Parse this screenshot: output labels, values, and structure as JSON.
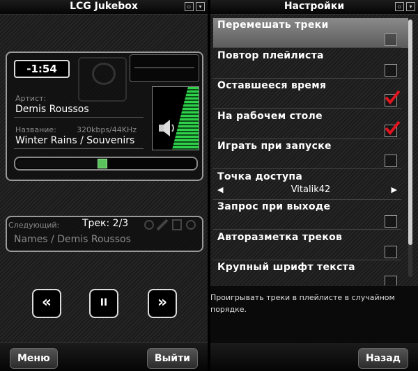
{
  "left": {
    "title": "LCG Jukebox",
    "time": "-1:54",
    "artist_label": "Артист:",
    "artist": "Demis Roussos",
    "track_label": "Название:",
    "bitrate": "320kbps/44KHz",
    "track_name": "Winter Rains / Souvenirs",
    "progress_fraction": 0.48,
    "next_label": "Следующий:",
    "track_counter": "Трек: 2/3",
    "next_track": "Names / Demis Roussos",
    "controls": {
      "prev": "«",
      "pause": "II",
      "next": "»"
    },
    "menu_label": "Меню",
    "exit_label": "Выйти"
  },
  "right": {
    "title": "Настройки",
    "items": [
      {
        "label": "Перемешать треки",
        "checked": false,
        "selected": true
      },
      {
        "label": "Повтор плейлиста",
        "checked": false
      },
      {
        "label": "Оставшееся время",
        "checked": true
      },
      {
        "label": "На рабочем столе",
        "checked": true
      },
      {
        "label": "Играть при запуске",
        "checked": false
      },
      {
        "label": "Точка доступа",
        "value": "Vitalik42"
      },
      {
        "label": "Запрос при выходе",
        "checked": false
      },
      {
        "label": "Авторазметка треков",
        "checked": false
      },
      {
        "label": "Крупный шрифт текста",
        "checked": false
      }
    ],
    "hint": "Проигрывать треки в плейлисте в случайном порядке.",
    "back_label": "Назад"
  },
  "colors": {
    "accent_green": "#2fd04a",
    "check_red": "#e0141e"
  }
}
